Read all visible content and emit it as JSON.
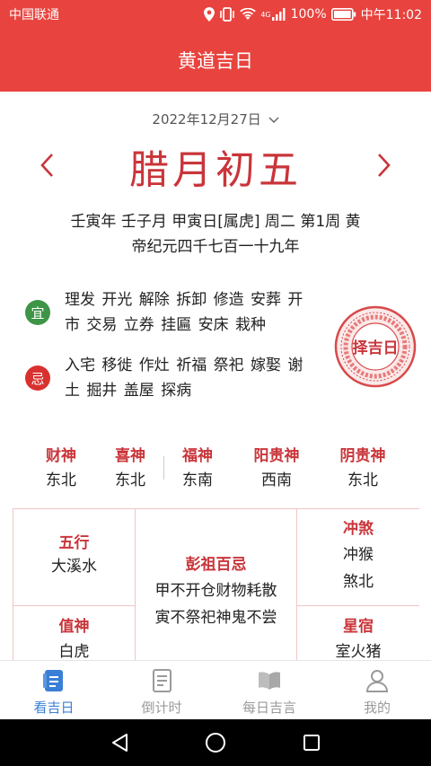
{
  "status_bar": {
    "carrier": "中国联通",
    "network": "4G",
    "battery": "100%",
    "time": "中午11:02"
  },
  "app_bar": {
    "title": "黄道吉日"
  },
  "date_selector": {
    "date": "2022年12月27日"
  },
  "lunar_date": "腊月初五",
  "ganzhi": {
    "line1": "壬寅年 壬子月 甲寅日[属虎] 周二 第1周 黄",
    "line2": "帝纪元四千七百一十九年"
  },
  "yi": {
    "badge": "宜",
    "line1": "理发 开光 解除 拆卸 修造 安葬 开",
    "line2": "市 交易 立券 挂匾 安床 栽种"
  },
  "ji": {
    "badge": "忌",
    "line1": "入宅 移徙 作灶 祈福 祭祀 嫁娶 谢",
    "line2": "土 掘井 盖屋 探病"
  },
  "seal": {
    "label": "择吉日"
  },
  "gods": [
    {
      "name": "财神",
      "dir": "东北"
    },
    {
      "name": "喜神",
      "dir": "东北"
    },
    {
      "name": "福神",
      "dir": "东南"
    },
    {
      "name": "阳贵神",
      "dir": "西南"
    },
    {
      "name": "阴贵神",
      "dir": "东北"
    }
  ],
  "grid": {
    "wuxing": {
      "title": "五行",
      "value": "大溪水"
    },
    "pengzu": {
      "title": "彭祖百忌",
      "line1": "甲不开仓财物耗散",
      "line2": "寅不祭祀神鬼不尝"
    },
    "chongsha": {
      "title": "冲煞",
      "line1": "冲猴",
      "line2": "煞北"
    },
    "zhishen": {
      "title": "值神",
      "value": "白虎"
    },
    "xingxiu": {
      "title": "星宿",
      "value": "室火猪"
    }
  },
  "tabs": [
    {
      "label": "看吉日",
      "icon": "calendar-doc-icon",
      "active": true
    },
    {
      "label": "倒计时",
      "icon": "countdown-doc-icon",
      "active": false
    },
    {
      "label": "每日吉言",
      "icon": "book-icon",
      "active": false
    },
    {
      "label": "我的",
      "icon": "person-icon",
      "active": false
    }
  ],
  "colors": {
    "brand_red": "#e8433e",
    "title_red": "#c9353a",
    "yi_green": "#3e9447",
    "ji_red": "#d9312f",
    "tab_active": "#3a7fd6",
    "tab_inactive": "#9a9a9a"
  }
}
